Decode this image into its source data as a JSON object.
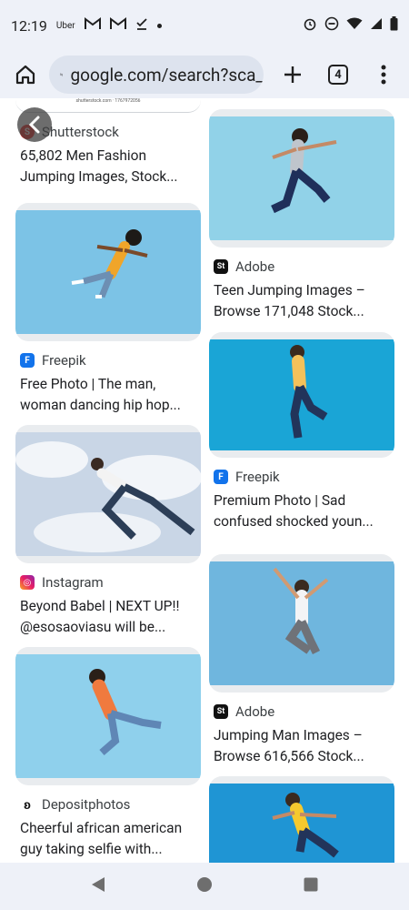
{
  "status_bar": {
    "time": "12:19",
    "notification_icons": [
      "uber-icon",
      "gmail-icon",
      "gmail-icon",
      "check-download-icon",
      "dot-icon"
    ],
    "uber_label": "Uber",
    "system_icons": [
      "alarm-icon",
      "do-not-disturb-icon",
      "wifi-icon",
      "signal-icon",
      "battery-icon"
    ]
  },
  "toolbar": {
    "url": "google.com/search?sca_",
    "tab_count": "4"
  },
  "results": {
    "left": [
      {
        "source": "Shutterstock",
        "favicon": "shutterstock-icon",
        "title": "65,802 Men Fashion Jumping Images, Stock...",
        "thumb_caption": "shutterstock.com · 1767972056"
      },
      {
        "source": "Freepik",
        "favicon": "freepik-icon",
        "title": "Free Photo | The man, woman dancing hip hop..."
      },
      {
        "source": "Instagram",
        "favicon": "instagram-icon",
        "title": "Beyond Babel | NEXT UP!! @esosaoviasu will be..."
      },
      {
        "source": "Depositphotos",
        "favicon": "depositphotos-icon",
        "title": "Cheerful african american guy taking selfie with..."
      }
    ],
    "right": [
      {
        "source": "Adobe",
        "favicon": "adobe-stock-icon",
        "title": "Teen Jumping Images – Browse 171,048 Stock..."
      },
      {
        "source": "Freepik",
        "favicon": "freepik-icon",
        "title": "Premium Photo | Sad confused shocked youn..."
      },
      {
        "source": "Adobe",
        "favicon": "adobe-stock-icon",
        "title": "Jumping Man Images – Browse 616,566 Stock..."
      },
      {
        "source": "",
        "favicon": "",
        "title": ""
      }
    ]
  },
  "colors": {
    "chrome_bg": "#eef1f8",
    "url_bg": "#dde3ee",
    "sky_blue": "#8fd0ec",
    "freepik_blue": "#1273eb"
  }
}
